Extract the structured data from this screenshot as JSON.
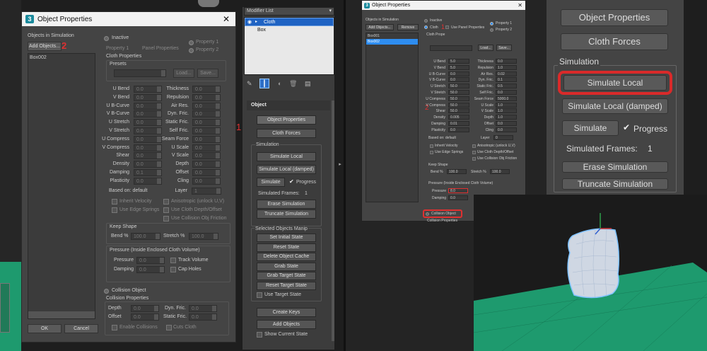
{
  "left_dialog": {
    "title": "Object Properties",
    "objects_in_sim_label": "Objects in Simulation",
    "add_objects": "Add Objects...",
    "remove": "Remove",
    "list_item": "Box002",
    "inactive": "Inactive",
    "property1": "Property 1",
    "panel_properties": "Panel Properties",
    "prop_radio1": "Property 1",
    "prop_radio2": "Property 2",
    "cloth_properties": "Cloth Properties",
    "presets": "Presets",
    "load": "Load...",
    "save": "Save...",
    "fields_left": [
      {
        "l": "U Bend",
        "v": "0.0"
      },
      {
        "l": "V Bend",
        "v": "0.0"
      },
      {
        "l": "U B-Curve",
        "v": "0.0"
      },
      {
        "l": "V B-Curve",
        "v": "0.0"
      },
      {
        "l": "U Stretch",
        "v": "0.0"
      },
      {
        "l": "V Stretch",
        "v": "0.0"
      },
      {
        "l": "U Compress",
        "v": "0.0"
      },
      {
        "l": "V Compress",
        "v": "0.0"
      },
      {
        "l": "Shear",
        "v": "0.0"
      },
      {
        "l": "Density",
        "v": "0.0"
      },
      {
        "l": "Damping",
        "v": "0.1"
      },
      {
        "l": "Plasticity",
        "v": "0.0"
      }
    ],
    "fields_right": [
      {
        "l": "Thickness",
        "v": "0.0"
      },
      {
        "l": "Repulsion",
        "v": "0.0"
      },
      {
        "l": "Air Res.",
        "v": "0.0"
      },
      {
        "l": "Dyn. Fric.",
        "v": "0.0"
      },
      {
        "l": "Static Fric.",
        "v": "0.0"
      },
      {
        "l": "Self Fric.",
        "v": "0.0"
      },
      {
        "l": "Seam Force",
        "v": "0.0"
      },
      {
        "l": "U Scale",
        "v": "0.0"
      },
      {
        "l": "V Scale",
        "v": "0.0"
      },
      {
        "l": "Depth",
        "v": "0.0"
      },
      {
        "l": "Offset",
        "v": "0.0"
      },
      {
        "l": "Cling",
        "v": "0.0"
      }
    ],
    "based_on": "Based on: default",
    "layer": "Layer",
    "layer_val": "1",
    "inherit_velocity": "Inherit Velocity",
    "anisotropic": "Anisotropic (unlock U,V)",
    "use_edge_springs": "Use Edge Springs",
    "use_cloth_depth": "Use Cloth Depth/Offset",
    "use_collision_friction": "Use Collision Obj Friction",
    "keep_shape": "Keep Shape",
    "bend_pct": "Bend %",
    "bend_val": "100.0",
    "stretch_pct": "Stretch %",
    "stretch_val": "100.0",
    "pressure_title": "Pressure (Inside Enclosed Cloth Volume)",
    "pressure": "Pressure",
    "pressure_val": "0.0",
    "track_volume": "Track Volume",
    "damping": "Damping",
    "damping_val": "0.0",
    "cap_holes": "Cap Holes",
    "collision_object": "Collision Object",
    "collision_properties": "Collision Properties",
    "depth": "Depth",
    "depth_val": "0.0",
    "dyn_fric": "Dyn. Fric.",
    "dyn_fric_val": "0.0",
    "offset": "Offset",
    "offset_val": "0.0",
    "static_fric": "Static Fric.",
    "static_fric_val": "0.0",
    "enable_collisions": "Enable Collisions",
    "cuts_cloth": "Cuts Cloth",
    "ok": "OK",
    "cancel": "Cancel",
    "marker2": "2"
  },
  "command_panel": {
    "modifier_list": "Modifier List",
    "stack": [
      "Cloth",
      "Box"
    ],
    "rollout": "Object",
    "buttons": [
      "Object Properties",
      "Cloth Forces"
    ],
    "simulation": "Simulation",
    "sim_buttons": [
      "Simulate Local",
      "Simulate Local (damped)"
    ],
    "simulate": "Simulate",
    "progress": "Progress",
    "simulated_frames": "Simulated Frames:",
    "frames_val": "1",
    "erase": "Erase Simulation",
    "truncate": "Truncate Simulation",
    "selected_manip": "Selected Objects Manip",
    "manip_buttons": [
      "Set Initial State",
      "Reset State",
      "Delete Object Cache",
      "Grab State",
      "Grab Target State",
      "Reset Target State"
    ],
    "use_target_state": "Use Target State",
    "create_keys": "Create Keys",
    "add_objects": "Add Objects",
    "show_current_state": "Show Current State",
    "marker1": "1"
  },
  "right_dialog": {
    "title": "Object Properties",
    "objects_in_sim_label": "Objects in Simulation",
    "add_objects": "Add Objects...",
    "remove": "Remove",
    "list": [
      "Box001",
      "Box002"
    ],
    "inactive": "Inactive",
    "cloth": "Cloth",
    "use_panel_properties": "Use Panel Properties",
    "property1": "Property 1",
    "property2": "Property 2",
    "cloth_prope": "Cloth Prope",
    "load": "Load...",
    "save": "Save...",
    "marker1": "1",
    "marker2": "2",
    "fields_left": [
      {
        "l": "U Bend",
        "v": "5.0"
      },
      {
        "l": "V Bend",
        "v": "5.0"
      },
      {
        "l": "U B-Curve",
        "v": "0.0"
      },
      {
        "l": "V B-Curve",
        "v": "0.0"
      },
      {
        "l": "U Stretch",
        "v": "50.0"
      },
      {
        "l": "V Stretch",
        "v": "50.0"
      },
      {
        "l": "U Compress",
        "v": "50.0"
      },
      {
        "l": "V Compress",
        "v": "50.0"
      },
      {
        "l": "Shear",
        "v": "50.0"
      },
      {
        "l": "Density",
        "v": "0.005"
      },
      {
        "l": "Damping",
        "v": "0.01"
      },
      {
        "l": "Plasticity",
        "v": "0.0"
      }
    ],
    "fields_right": [
      {
        "l": "Thickness",
        "v": "0.0"
      },
      {
        "l": "Repulsion",
        "v": "1.0"
      },
      {
        "l": "Air Res.",
        "v": "0.02"
      },
      {
        "l": "Dyn. Fric.",
        "v": "0.1"
      },
      {
        "l": "Static Fric.",
        "v": "0.5"
      },
      {
        "l": "Self Fric.",
        "v": "0.0"
      },
      {
        "l": "Seam Force",
        "v": "5000.0"
      },
      {
        "l": "U Scale",
        "v": "1.0"
      },
      {
        "l": "V Scale",
        "v": "1.0"
      },
      {
        "l": "Depth",
        "v": "1.0"
      },
      {
        "l": "Offset",
        "v": "0.0"
      },
      {
        "l": "Cling",
        "v": "0.0"
      }
    ],
    "based_on": "Based on: default",
    "layer": "Layer",
    "layer_val": "0",
    "inherit_velocity": "Inherit Velocity",
    "anisotropic": "Anisotropic (unlock U,V)",
    "use_edge_springs": "Use Edge Springs",
    "use_cloth_depth": "Use Cloth Depth/Offset",
    "use_collision_friction": "Use Collision Obj Friction",
    "keep_shape": "Keep Shape",
    "bend_pct": "Bend %",
    "bend_val": "100.0",
    "stretch_pct": "Stretch %",
    "stretch_val": "100.0",
    "pressure_title": "Pressure (Inside Enclosed Cloth Volume)",
    "pressure": "Pressure",
    "pressure_val": "8.0",
    "damping": "Damping",
    "damping_val": "0.0",
    "collision_object": "Collision Object",
    "collision_properties": "Collision Properties"
  },
  "zoom_panel": {
    "object_properties": "Object Properties",
    "cloth_forces": "Cloth Forces",
    "simulation": "Simulation",
    "simulate_local": "Simulate Local",
    "simulate_local_damped": "Simulate Local (damped)",
    "simulate": "Simulate",
    "progress": "Progress",
    "simulated_frames": "Simulated Frames:",
    "frames_val": "1",
    "erase": "Erase Simulation",
    "truncate": "Truncate Simulation"
  },
  "colors": {
    "accent_blue": "#2e8df0",
    "highlight_red": "#e03030",
    "ground_green": "#1e9a6e"
  }
}
